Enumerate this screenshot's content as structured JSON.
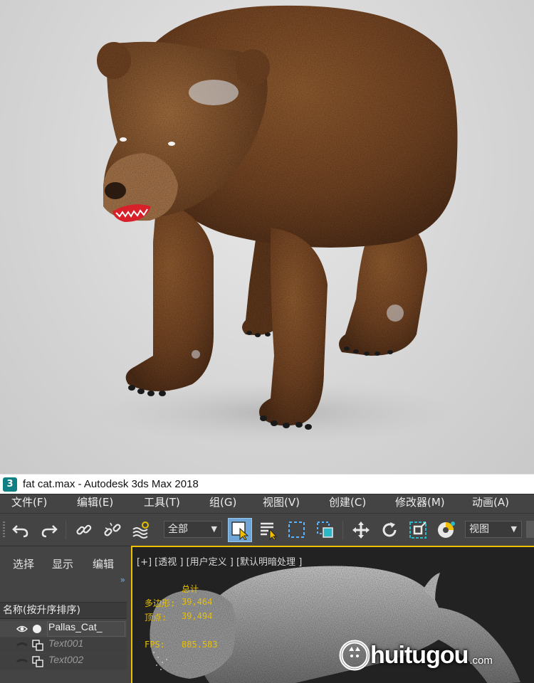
{
  "window": {
    "app_icon_glyph": "3",
    "title": "fat cat.max - Autodesk 3ds Max 2018"
  },
  "menu": {
    "items": [
      "文件(F)",
      "编辑(E)",
      "工具(T)",
      "组(G)",
      "视图(V)",
      "创建(C)",
      "修改器(M)",
      "动画(A)"
    ]
  },
  "toolbar": {
    "selection_filter": "全部",
    "reference_coord": "视图",
    "icons": [
      "undo-icon",
      "redo-icon",
      "link-icon",
      "unlink-icon",
      "bind-space-warp-icon",
      "select-object-icon",
      "select-by-name-icon",
      "rectangular-selection-icon",
      "window-crossing-icon",
      "move-icon",
      "rotate-icon",
      "scale-icon",
      "render-setup-icon"
    ]
  },
  "scene_explorer": {
    "tabs": [
      "选择",
      "显示",
      "编辑"
    ],
    "column_header": "名称(按升序排序)",
    "rows": [
      {
        "name": "Pallas_Cat_",
        "hidden": false
      },
      {
        "name": "Text001",
        "hidden": true
      },
      {
        "name": "Text002",
        "hidden": true
      }
    ]
  },
  "viewport": {
    "label": "[+] [透视 ] [用户定义 ] [默认明暗处理 ]",
    "stats_title": "总计",
    "polys_label": "多边形:",
    "polys_value": "39,464",
    "verts_label": "顶点:",
    "verts_value": "39,494",
    "fps_label": "FPS:",
    "fps_value": "885.583",
    "active_border_color": "#f0c000"
  },
  "watermark": {
    "text": "huitugou",
    "domain": ".com"
  },
  "colors": {
    "ui_dark": "#444444",
    "active_button": "#6ea6d8",
    "stats_text": "#e8c000",
    "bear_fur": "#7a4a26"
  }
}
